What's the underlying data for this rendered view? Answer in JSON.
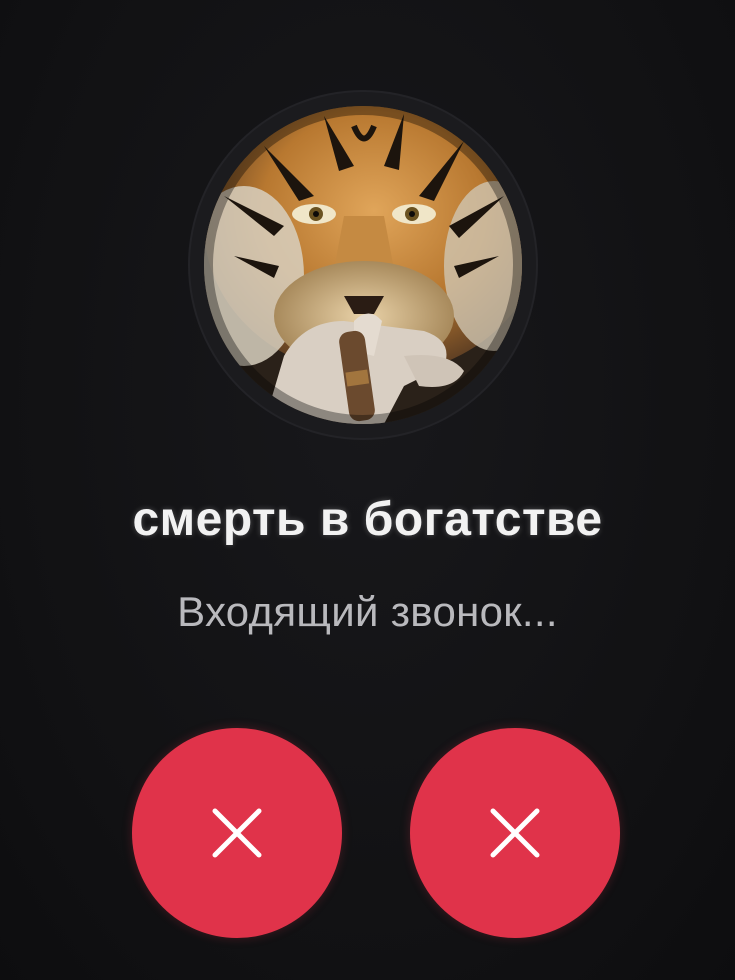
{
  "caller": {
    "name": "смерть в богатстве",
    "status": "Входящий звонок..."
  },
  "actions": {
    "left_button_icon": "close-icon",
    "right_button_icon": "close-icon"
  },
  "colors": {
    "background": "#121214",
    "decline_button": "#e0334a",
    "name_text": "#f2f2f2",
    "status_text": "#b9b9bd"
  }
}
